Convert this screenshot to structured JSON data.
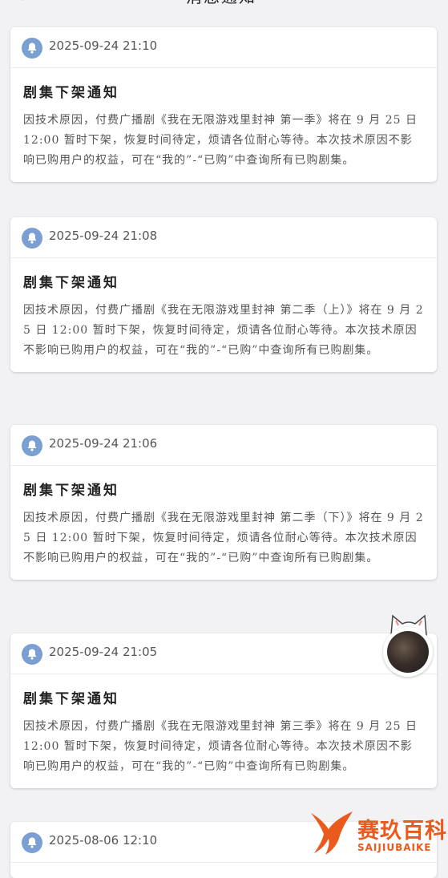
{
  "header": {
    "title": "消息通知"
  },
  "notifications": [
    {
      "time": "2025-09-24 21:10",
      "title": "剧集下架通知",
      "text": "因技术原因，付费广播剧《我在无限游戏里封神 第一季》将在 9 月 25 日 12:00 暂时下架，恢复时间待定，烦请各位耐心等待。本次技术原因不影响已购用户的权益，可在“我的”-“已购”中查询所有已购剧集。"
    },
    {
      "time": "2025-09-24 21:08",
      "title": "剧集下架通知",
      "text": "因技术原因，付费广播剧《我在无限游戏里封神 第二季（上）》将在 9 月 25 日 12:00 暂时下架，恢复时间待定，烦请各位耐心等待。本次技术原因不影响已购用户的权益，可在“我的”-“已购”中查询所有已购剧集。"
    },
    {
      "time": "2025-09-24 21:06",
      "title": "剧集下架通知",
      "text": "因技术原因，付费广播剧《我在无限游戏里封神 第二季（下）》将在 9 月 25 日 12:00 暂时下架，恢复时间待定，烦请各位耐心等待。本次技术原因不影响已购用户的权益，可在“我的”-“已购”中查询所有已购剧集。"
    },
    {
      "time": "2025-09-24 21:05",
      "title": "剧集下架通知",
      "text": "因技术原因，付费广播剧《我在无限游戏里封神 第三季》将在 9 月 25 日 12:00 暂时下架，恢复时间待定，烦请各位耐心等待。本次技术原因不影响已购用户的权益，可在“我的”-“已购”中查询所有已购剧集。"
    },
    {
      "time": "2025-08-06 12:10",
      "title": "",
      "text": ""
    }
  ],
  "watermark": {
    "name": "赛玖百科",
    "sub": "SAIJIUBAIKE"
  },
  "icons": {
    "notification": "bell-icon",
    "back": "back-icon",
    "floating": "cat-avatar-icon"
  },
  "colors": {
    "bell_bg": "#7b9fd3",
    "watermark": "#ea5a1c",
    "page_bg": "#f2f2f4"
  }
}
